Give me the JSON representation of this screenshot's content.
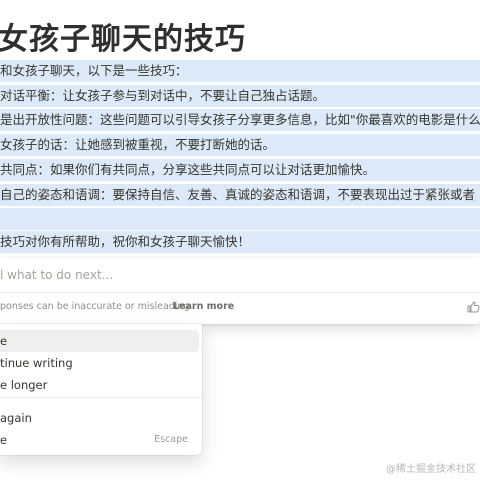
{
  "document": {
    "title": "女孩子聊天的技巧",
    "lines": [
      "和女孩子聊天，以下是一些技巧：",
      "对话平衡：让女孩子参与到对话中，不要让自己独占话题。",
      "是出开放性问题：这些问题可以引导女孩子分享更多信息，比如\"你最喜欢的电影是什么",
      "女孩子的话：让她感到被重视，不要打断她的话。",
      "共同点：如果你们有共同点，分享这些共同点可以让对话更加愉快。",
      "自己的姿态和语调：要保持自信、友善、真诚的姿态和语调，不要表现出过于紧张或者",
      "",
      "技巧对你有所帮助，祝你和女孩子聊天愉快！"
    ]
  },
  "ai_panel": {
    "input_placeholder": "l what to do next...",
    "input_value": "",
    "disclaimer": "ponses can be inaccurate or misleading.",
    "learn_more": "Learn more"
  },
  "menu": {
    "items": [
      {
        "label": "e",
        "shortcut": ""
      },
      {
        "label": "tinue writing",
        "shortcut": ""
      },
      {
        "label": "e longer",
        "shortcut": ""
      },
      {
        "label": "again",
        "shortcut": ""
      },
      {
        "label": "e",
        "shortcut": "Escape"
      }
    ]
  },
  "watermark": "@稀土掘金技术社区",
  "colors": {
    "highlight": "#dbe9f8",
    "menu_active": "#efefee",
    "text": "#37352f"
  },
  "icons": {
    "feedback": "thumbs-up-icon"
  }
}
